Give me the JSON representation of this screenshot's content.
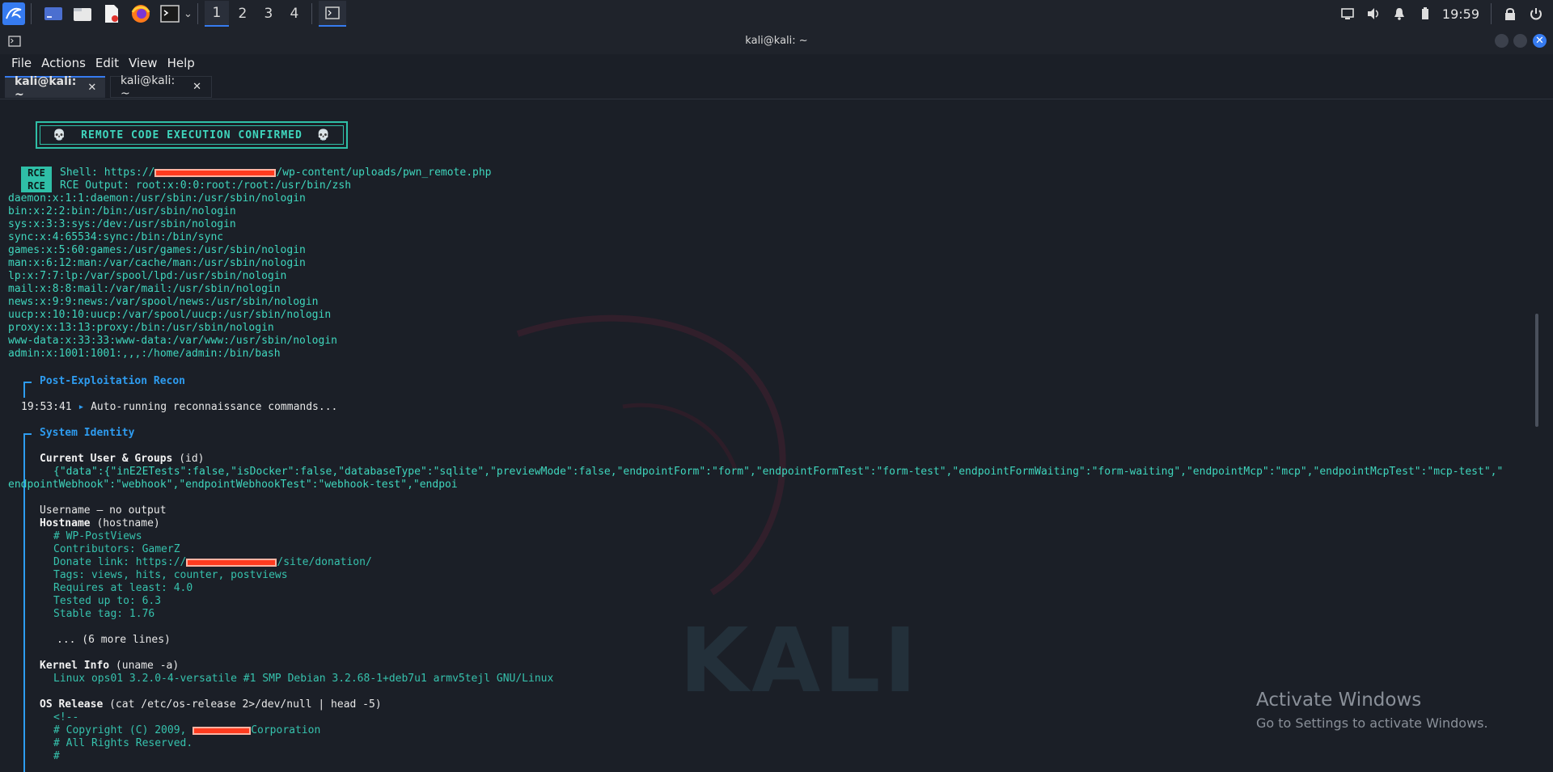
{
  "taskbar": {
    "workspaces": [
      "1",
      "2",
      "3",
      "4"
    ],
    "clock": "19:59",
    "colors": {
      "accent": "#367bf0",
      "panel": "#1f232b"
    }
  },
  "window": {
    "title": "kali@kali: ~",
    "menu": [
      "File",
      "Actions",
      "Edit",
      "View",
      "Help"
    ],
    "tabs": [
      {
        "label": "kali@kali: ~",
        "active": true
      },
      {
        "label": "kali@kali: ~",
        "active": false
      }
    ]
  },
  "terminal": {
    "banner": "💀  REMOTE CODE EXECUTION CONFIRMED  💀",
    "badge": "RCE",
    "shell_prefix": "Shell: https://",
    "shell_suffix": "/wp-content/uploads/pwn_remote.php",
    "rce_output": "RCE Output: root:x:0:0:root:/root:/usr/bin/zsh",
    "passwd": [
      "daemon:x:1:1:daemon:/usr/sbin:/usr/sbin/nologin",
      "bin:x:2:2:bin:/bin:/usr/sbin/nologin",
      "sys:x:3:3:sys:/dev:/usr/sbin/nologin",
      "sync:x:4:65534:sync:/bin:/bin/sync",
      "games:x:5:60:games:/usr/games:/usr/sbin/nologin",
      "man:x:6:12:man:/var/cache/man:/usr/sbin/nologin",
      "lp:x:7:7:lp:/var/spool/lpd:/usr/sbin/nologin",
      "mail:x:8:8:mail:/var/mail:/usr/sbin/nologin",
      "news:x:9:9:news:/var/spool/news:/usr/sbin/nologin",
      "uucp:x:10:10:uucp:/var/spool/uucp:/usr/sbin/nologin",
      "proxy:x:13:13:proxy:/bin:/usr/sbin/nologin",
      "www-data:x:33:33:www-data:/var/www:/usr/sbin/nologin",
      "admin:x:1001:1001:,,,:/home/admin:/bin/bash"
    ],
    "post_recon_header": "Post-Exploitation Recon",
    "recon_time": "19:53:41",
    "recon_arrow": "▸",
    "recon_msg": "Auto-running reconnaissance commands...",
    "identity_header": "System Identity",
    "user_groups_title": "Current User & Groups",
    "user_groups_cmd": " (id)",
    "user_groups_out1": "{\"data\":{\"inE2ETests\":false,\"isDocker\":false,\"databaseType\":\"sqlite\",\"previewMode\":false,\"endpointForm\":\"form\",\"endpointFormTest\":\"form-test\",\"endpointFormWaiting\":\"form-waiting\",\"endpointMcp\":\"mcp\",\"endpointMcpTest\":\"mcp-test\",\"",
    "user_groups_out2": "endpointWebhook\":\"webhook\",\"endpointWebhookTest\":\"webhook-test\",\"endpoi",
    "username_line": "Username — no output",
    "hostname_title": "Hostname",
    "hostname_cmd": " (hostname)",
    "hostname_out": [
      "# WP-PostViews",
      "Contributors: GamerZ"
    ],
    "donate_prefix": "Donate link: https://",
    "donate_suffix": "/site/donation/",
    "hostname_out2": [
      "Tags: views, hits, counter, postviews",
      "Requires at least: 4.0",
      "Tested up to: 6.3",
      "Stable tag: 1.76"
    ],
    "more_lines": "... (6 more lines)",
    "kernel_title": "Kernel Info",
    "kernel_cmd": " (uname -a)",
    "kernel_out": "Linux ops01 3.2.0-4-versatile #1 SMP Debian 3.2.68-1+deb7u1 armv5tejl GNU/Linux",
    "os_title": "OS Release",
    "os_cmd": " (cat /etc/os-release 2>/dev/null | head -5)",
    "os_out0": "<!--",
    "os_copyright_prefix": "# Copyright (C) 2009, ",
    "os_copyright_suffix": "Corporation",
    "os_out2": "# All Rights Reserved.",
    "os_out3": "#",
    "watermark": "KALI"
  },
  "activation": {
    "title": "Activate Windows",
    "subtitle": "Go to Settings to activate Windows."
  }
}
